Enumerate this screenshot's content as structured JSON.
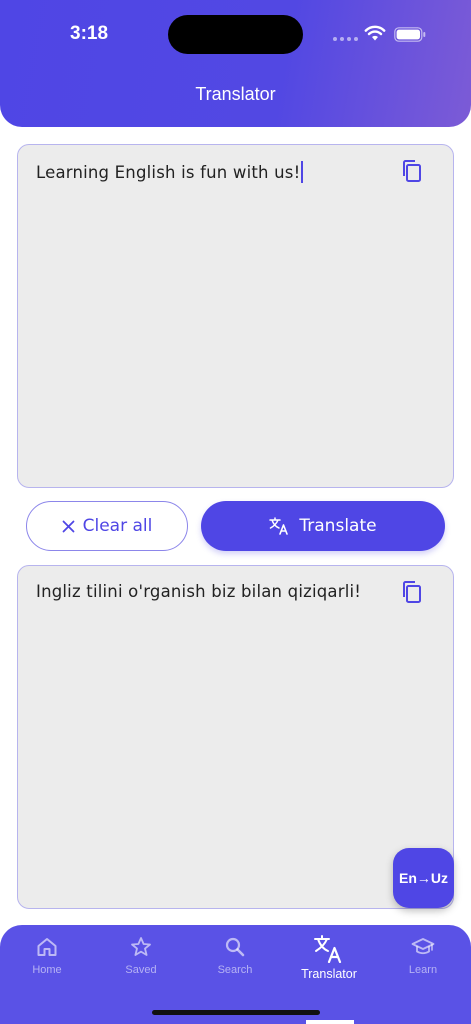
{
  "status_bar": {
    "time": "3:18"
  },
  "header": {
    "title": "Translator"
  },
  "source": {
    "text": "Learning English is fun with us!"
  },
  "actions": {
    "clear_label": "Clear all",
    "translate_label": "Translate"
  },
  "result": {
    "text": "Ingliz tilini o'rganish biz bilan qiziqarli!"
  },
  "direction_button": {
    "label": "En→Uz"
  },
  "tabs": [
    {
      "label": "Home",
      "icon": "home-icon",
      "active": false
    },
    {
      "label": "Saved",
      "icon": "star-icon",
      "active": false
    },
    {
      "label": "Search",
      "icon": "search-icon",
      "active": false
    },
    {
      "label": "Translator",
      "icon": "translate-icon",
      "active": true
    },
    {
      "label": "Learn",
      "icon": "graduation-cap-icon",
      "active": false
    }
  ],
  "colors": {
    "accent": "#4f46e5",
    "tabbar": "#5a52e6",
    "box_bg": "#ececec",
    "box_border": "#b7b4ee"
  }
}
